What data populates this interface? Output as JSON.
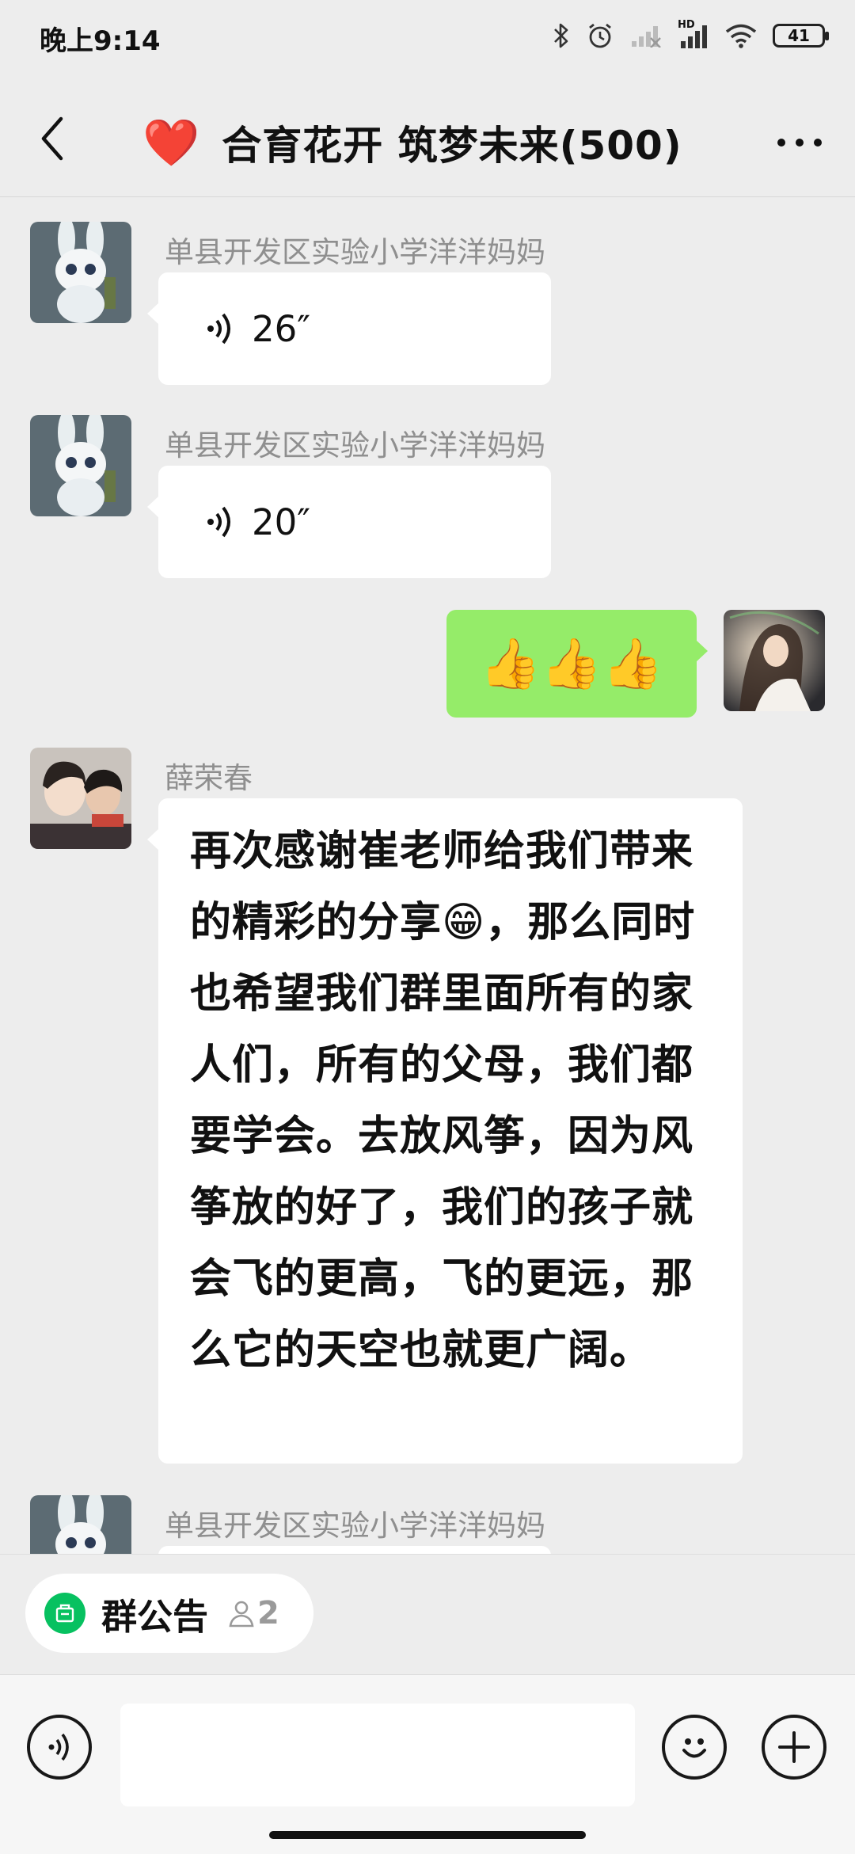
{
  "status_bar": {
    "time": "晚上9:14",
    "battery": "41",
    "network_label": "HD"
  },
  "header": {
    "title_emoji": "❤️",
    "title": "合育花开 筑梦未来(500)"
  },
  "messages": [
    {
      "sender": "单县开发区实验小学洋洋妈妈",
      "type": "voice",
      "duration": "26″"
    },
    {
      "sender": "单县开发区实验小学洋洋妈妈",
      "type": "voice",
      "duration": "20″"
    },
    {
      "sender": "",
      "type": "emoji",
      "content": "👍👍👍"
    },
    {
      "sender": "薛荣春",
      "type": "text",
      "content_part1": "再次感谢崔老师给我们带来的精彩的分享",
      "content_emoji": "😁",
      "content_part2": "，那么同时也希望我们群里面所有的家人们，所有的父母，我们都要学会。去放风筝，因为风筝放的好了，我们的孩子就会飞的更高，飞的更远，那么它的天空也就更广阔。"
    },
    {
      "sender": "单县开发区实验小学洋洋妈妈",
      "type": "partial"
    }
  ],
  "announcement": {
    "label": "群公告",
    "count": "2"
  },
  "input": {
    "placeholder": ""
  },
  "colors": {
    "background": "#ededed",
    "self_bubble": "#95ec69",
    "other_bubble": "#ffffff",
    "accent": "#07c160"
  }
}
